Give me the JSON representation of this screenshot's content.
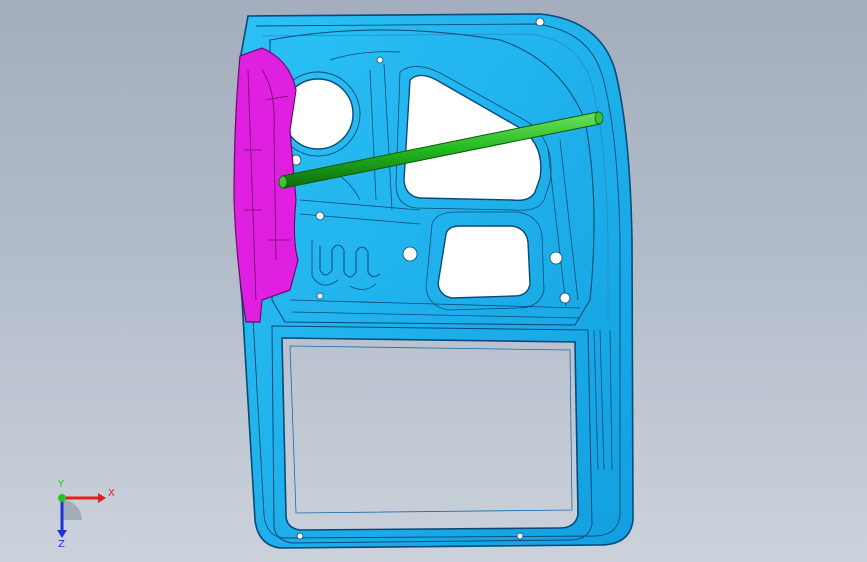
{
  "viewport": {
    "background_top": "#a3adbd",
    "background_bottom": "#cbd2dc"
  },
  "model": {
    "parts": [
      {
        "name": "door-inner-panel",
        "color": "#1fb4f0"
      },
      {
        "name": "hinge-reinforcement",
        "color": "#e020e0"
      },
      {
        "name": "intrusion-beam",
        "color": "#22b81e"
      }
    ]
  },
  "triad": {
    "x_label": "X",
    "y_label": "Y",
    "z_label": "Z",
    "x_color": "#e0201e",
    "y_color": "#1ec81e",
    "z_color": "#2030d8"
  }
}
